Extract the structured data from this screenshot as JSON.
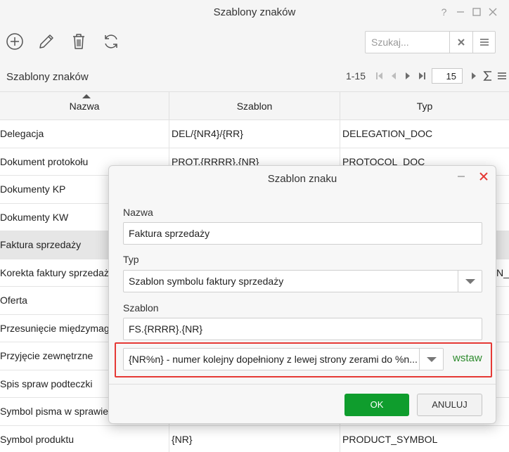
{
  "window": {
    "title": "Szablony znaków",
    "buttons": {
      "help": "?"
    }
  },
  "toolbar": {
    "icons": [
      "add-icon",
      "edit-icon",
      "trash-icon",
      "refresh-icon"
    ],
    "search": {
      "placeholder": "Szukaj...",
      "value": ""
    }
  },
  "grid": {
    "title": "Szablony znaków",
    "pager": {
      "range": "1-15",
      "page_size": "15"
    },
    "columns": [
      "Nazwa",
      "Szablon",
      "Typ"
    ],
    "sort": {
      "column": "Nazwa",
      "direction": "ascending"
    },
    "rows": [
      {
        "name": "Delegacja",
        "template": "DEL/{NR4}/{RR}",
        "type": "DELEGATION_DOC",
        "selected": false
      },
      {
        "name": "Dokument protokołu",
        "template": "PROT.{RRRR}.{NR}",
        "type": "PROTOCOL_DOC",
        "selected": false
      },
      {
        "name": "Dokumenty KP",
        "template": "",
        "type": "",
        "selected": false
      },
      {
        "name": "Dokumenty KW",
        "template": "",
        "type": "",
        "selected": false
      },
      {
        "name": "Faktura sprzedaży",
        "template": "",
        "type": "",
        "selected": true
      },
      {
        "name": "Korekta faktury sprzedaż",
        "template": "",
        "type": "N_",
        "selected": false
      },
      {
        "name": "Oferta",
        "template": "",
        "type": "",
        "selected": false
      },
      {
        "name": "Przesunięcie międzymag",
        "template": "",
        "type": "",
        "selected": false
      },
      {
        "name": "Przyjęcie zewnętrzne",
        "template": "",
        "type": "",
        "selected": false
      },
      {
        "name": "Spis spraw podteczki",
        "template": "",
        "type": "",
        "selected": false
      },
      {
        "name": "Symbol pisma w sprawie",
        "template": "",
        "type": "",
        "selected": false
      },
      {
        "name": "Symbol produktu",
        "template": "{NR}",
        "type": "PRODUCT_SYMBOL",
        "selected": false
      }
    ]
  },
  "modal": {
    "title": "Szablon znaku",
    "name_label": "Nazwa",
    "name_value": "Faktura sprzedaży",
    "type_label": "Typ",
    "type_value": "Szablon symbolu faktury sprzedaży",
    "template_label": "Szablon",
    "template_value": "FS.{RRRR}.{NR}",
    "token_value": "{NR%n} - numer kolejny dopełniony z lewej strony zerami do %n...",
    "insert_label": "wstaw",
    "ok_label": "OK",
    "cancel_label": "ANULUJ",
    "highlight_color": "#e53935",
    "ok_color": "#0f9d2d",
    "insert_color": "#2e8b2e"
  }
}
